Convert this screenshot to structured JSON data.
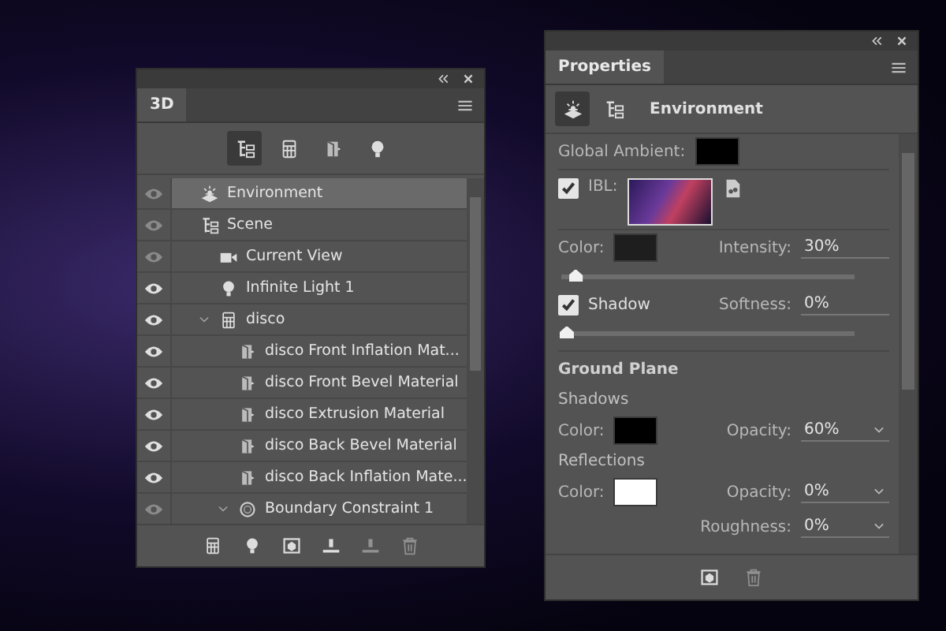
{
  "panel_3d": {
    "tab": "3D",
    "filters": [
      {
        "kind": "scene",
        "selected": true
      },
      {
        "kind": "mesh",
        "selected": false
      },
      {
        "kind": "material",
        "selected": false
      },
      {
        "kind": "light",
        "selected": false
      }
    ],
    "tree": [
      {
        "name": "Environment",
        "kind": "environment",
        "visible": false,
        "selected": true
      },
      {
        "name": "Scene",
        "kind": "scene",
        "visible": false,
        "selected": false,
        "children": [
          {
            "name": "Current View",
            "kind": "camera",
            "visible": false,
            "selected": false
          },
          {
            "name": "Infinite Light 1",
            "kind": "light",
            "visible": true,
            "selected": false
          },
          {
            "name": "disco",
            "kind": "mesh",
            "visible": true,
            "selected": false,
            "expanded": true,
            "children": [
              {
                "name": "disco Front Inflation Mat...",
                "kind": "material",
                "visible": true,
                "selected": false
              },
              {
                "name": "disco Front Bevel Material",
                "kind": "material",
                "visible": true,
                "selected": false
              },
              {
                "name": "disco Extrusion Material",
                "kind": "material",
                "visible": true,
                "selected": false
              },
              {
                "name": "disco Back Bevel Material",
                "kind": "material",
                "visible": true,
                "selected": false
              },
              {
                "name": "disco Back Inflation Mate...",
                "kind": "material",
                "visible": true,
                "selected": false
              },
              {
                "name": "Boundary Constraint 1",
                "kind": "constraint",
                "visible": false,
                "selected": false,
                "expanded": true
              }
            ]
          }
        ]
      }
    ],
    "tools": [
      {
        "kind": "mesh",
        "disabled": false
      },
      {
        "kind": "light",
        "disabled": false
      },
      {
        "kind": "render",
        "disabled": false
      },
      {
        "kind": "ground",
        "disabled": false
      },
      {
        "kind": "ground",
        "disabled": true
      },
      {
        "kind": "trash",
        "disabled": true
      }
    ]
  },
  "properties": {
    "tab": "Properties",
    "modes": [
      {
        "kind": "environment",
        "selected": true
      },
      {
        "kind": "scene",
        "selected": false
      }
    ],
    "title": "Environment",
    "global_ambient": {
      "label": "Global Ambient:",
      "color": "#000000"
    },
    "ibl": {
      "label": "IBL:",
      "checked": true
    },
    "ibl_color": {
      "label": "Color:",
      "color": "#1e1e1e"
    },
    "intensity": {
      "label": "Intensity:",
      "value": "30%",
      "level": 0.03
    },
    "shadow": {
      "label": "Shadow",
      "checked": true
    },
    "softness": {
      "label": "Softness:",
      "value": "0%",
      "level": 0
    },
    "ground_plane": {
      "heading": "Ground Plane",
      "shadows": {
        "heading": "Shadows",
        "color_label": "Color:",
        "color": "#000000",
        "opacity_label": "Opacity:",
        "opacity": "60%"
      },
      "reflections": {
        "heading": "Reflections",
        "color_label": "Color:",
        "color": "#ffffff",
        "opacity_label": "Opacity:",
        "opacity": "0%",
        "roughness_label": "Roughness:",
        "roughness": "0%"
      }
    }
  }
}
